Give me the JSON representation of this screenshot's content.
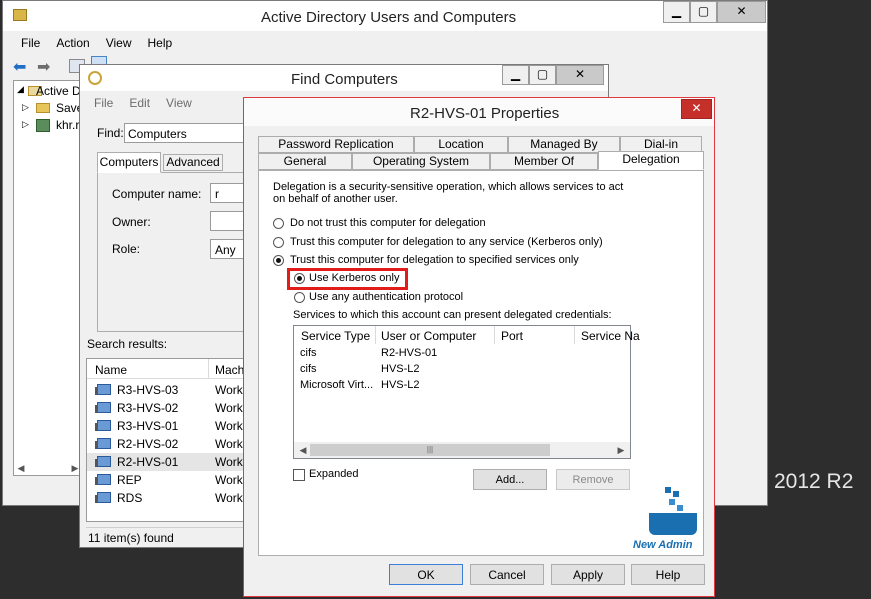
{
  "ad_window": {
    "title": "Active Directory Users and Computers",
    "menu": [
      "File",
      "Action",
      "View",
      "Help"
    ],
    "tree": [
      "Active D",
      "Save",
      "khr.r"
    ]
  },
  "find_window": {
    "title": "Find Computers",
    "menu": [
      "File",
      "Edit",
      "View"
    ],
    "find_label": "Find:",
    "find_value": "Computers",
    "tabs": [
      "Computers",
      "Advanced"
    ],
    "computer_name_label": "Computer name:",
    "computer_name_value": "r",
    "owner_label": "Owner:",
    "role_label": "Role:",
    "role_value": "Any",
    "search_results_label": "Search results:",
    "columns": [
      "Name",
      "Mach"
    ],
    "rows": [
      {
        "name": "R3-HVS-03",
        "type": "Work"
      },
      {
        "name": "R3-HVS-02",
        "type": "Work"
      },
      {
        "name": "R3-HVS-01",
        "type": "Work"
      },
      {
        "name": "R2-HVS-02",
        "type": "Work"
      },
      {
        "name": "R2-HVS-01",
        "type": "Work"
      },
      {
        "name": "REP",
        "type": "Work"
      },
      {
        "name": "RDS",
        "type": "Work"
      }
    ],
    "status": "11 item(s) found"
  },
  "props_dialog": {
    "title": "R2-HVS-01 Properties",
    "tabs_row1": [
      "Password Replication",
      "Location",
      "Managed By",
      "Dial-in"
    ],
    "tabs_row2": [
      "General",
      "Operating System",
      "Member Of",
      "Delegation"
    ],
    "description": "Delegation is a security-sensitive operation, which allows services to act on behalf of another user.",
    "options": [
      "Do not trust this computer for delegation",
      "Trust this computer for delegation to any service (Kerberos only)",
      "Trust this computer for delegation to specified services only"
    ],
    "sub_options": [
      "Use Kerberos only",
      "Use any authentication protocol"
    ],
    "services_label": "Services to which this account can present delegated credentials:",
    "columns": [
      "Service Type",
      "User or Computer",
      "Port",
      "Service Na"
    ],
    "services": [
      {
        "type": "cifs",
        "host": "R2-HVS-01"
      },
      {
        "type": "cifs",
        "host": "HVS-L2"
      },
      {
        "type": "Microsoft Virt...",
        "host": "HVS-L2"
      }
    ],
    "expanded_label": "Expanded",
    "add_label": "Add...",
    "remove_label": "Remove",
    "buttons": [
      "OK",
      "Cancel",
      "Apply",
      "Help"
    ],
    "logo_text": "New Admin"
  },
  "background": {
    "caption": "2012 R2"
  },
  "colors": {
    "highlight": "#e21b1b",
    "dialog_border": "#e0393f",
    "logo_blue": "#1a6fb0"
  }
}
